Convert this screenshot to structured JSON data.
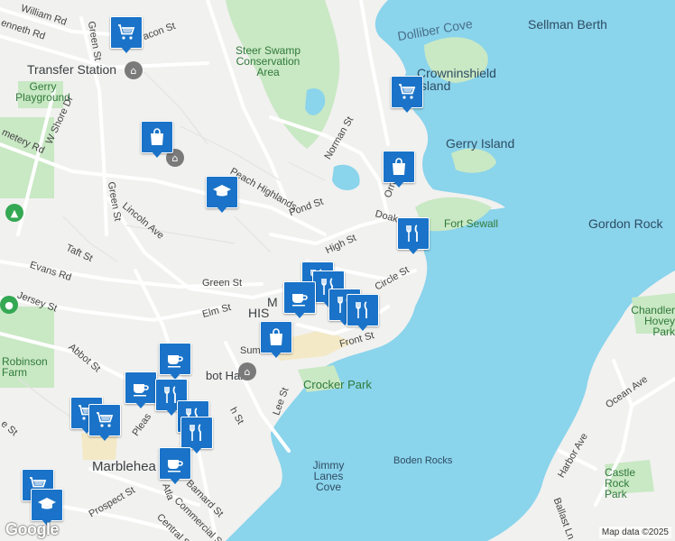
{
  "map": {
    "attribution": "Map data ©2025",
    "logo": "Google",
    "colors": {
      "water": "#8ad4ec",
      "land": "#f1f1ef",
      "park": "#c9e8c4",
      "road": "#ffffff",
      "marker": "#1a73c8"
    },
    "labels": {
      "william_rd": "William Rd",
      "kenneth_rd": "enneth Rd",
      "green_st_n": "Green St",
      "acon_st": "acon St",
      "transfer_station": "Transfer Station",
      "gerry_playground": "Gerry Playground",
      "steer_swamp": "Steer Swamp Conservation Area",
      "dolliber_cove": "Dolliber Cove",
      "sellman_berth": "Sellman Berth",
      "crowninshield_island": "Crowninshield Island",
      "w_shore_dr": "W Shore Dr",
      "cemetery_rd": "metery Rd",
      "norman_st": "Norman St",
      "gerry_island": "Gerry Island",
      "peach_highlands": "Peach Highlands",
      "pond_st": "Pond St",
      "orne": "Orn",
      "green_st_w": "Green St",
      "lincoln_ave": "Lincoln Ave",
      "doaks_ln": "Doaks Ln",
      "fort_sewall": "Fort Sewall",
      "gordon_rock": "Gordon Rock",
      "taft_st": "Taft St",
      "high_st": "High St",
      "evans_rd": "Evans Rd",
      "green_st_c": "Green St",
      "circle_st": "Circle St",
      "jersey_st": "Jersey St",
      "elm_st": "Elm St",
      "historic": "HIS",
      "historic_m": "M",
      "chandler_hovey_park": "Chandler Hovey Park",
      "front_st": "Front St",
      "robinson_farm": "Robinson Farm",
      "abbot_st": "Abbot St",
      "sumner": "Sum",
      "abbot_hall": "bot Hall",
      "crocker_park": "Crocker Park",
      "ocean_ave": "Ocean Ave",
      "lee_st": "Lee St",
      "pleasant_st": "Pleas",
      "washington": "h St",
      "marblehead": "Marblehea",
      "boden_rocks": "Boden Rocks",
      "harbor_ave": "Harbor Ave",
      "jimmy_lanes_cove": "Jimmy Lanes Cove",
      "castle_rock_park": "Castle Rock Park",
      "barnard_st": "Barnard St",
      "prospect_st": "Prospect St",
      "commercial_st": "Commercial St",
      "central_st": "Central St",
      "ballast_ln": "Ballast Ln",
      "atlantic": "Atla",
      "e_street": "e St"
    },
    "markers": [
      {
        "name": "grocery-marker",
        "icon": "shopping-cart-icon"
      },
      {
        "name": "grocery-marker",
        "icon": "shopping-cart-icon"
      },
      {
        "name": "shopping-marker",
        "icon": "shopping-bag-icon"
      },
      {
        "name": "school-marker",
        "icon": "graduation-cap-icon"
      },
      {
        "name": "shopping-marker",
        "icon": "shopping-bag-icon"
      },
      {
        "name": "restaurant-marker",
        "icon": "fork-knife-icon"
      },
      {
        "name": "restaurant-marker",
        "icon": "fork-knife-icon"
      },
      {
        "name": "restaurant-marker",
        "icon": "fork-knife-icon"
      },
      {
        "name": "cafe-marker",
        "icon": "coffee-cup-icon"
      },
      {
        "name": "restaurant-marker",
        "icon": "fork-knife-icon"
      },
      {
        "name": "restaurant-marker",
        "icon": "fork-knife-icon"
      },
      {
        "name": "shopping-marker",
        "icon": "shopping-bag-icon"
      },
      {
        "name": "cafe-marker",
        "icon": "coffee-cup-icon"
      },
      {
        "name": "cafe-marker",
        "icon": "coffee-cup-icon"
      },
      {
        "name": "restaurant-marker",
        "icon": "fork-knife-icon"
      },
      {
        "name": "restaurant-marker",
        "icon": "fork-knife-icon"
      },
      {
        "name": "grocery-marker",
        "icon": "shopping-cart-icon"
      },
      {
        "name": "grocery-marker",
        "icon": "shopping-cart-icon"
      },
      {
        "name": "restaurant-marker",
        "icon": "fork-knife-icon"
      },
      {
        "name": "cafe-marker",
        "icon": "coffee-cup-icon"
      },
      {
        "name": "grocery-marker",
        "icon": "shopping-cart-icon"
      },
      {
        "name": "school-marker",
        "icon": "graduation-cap-icon"
      }
    ]
  }
}
